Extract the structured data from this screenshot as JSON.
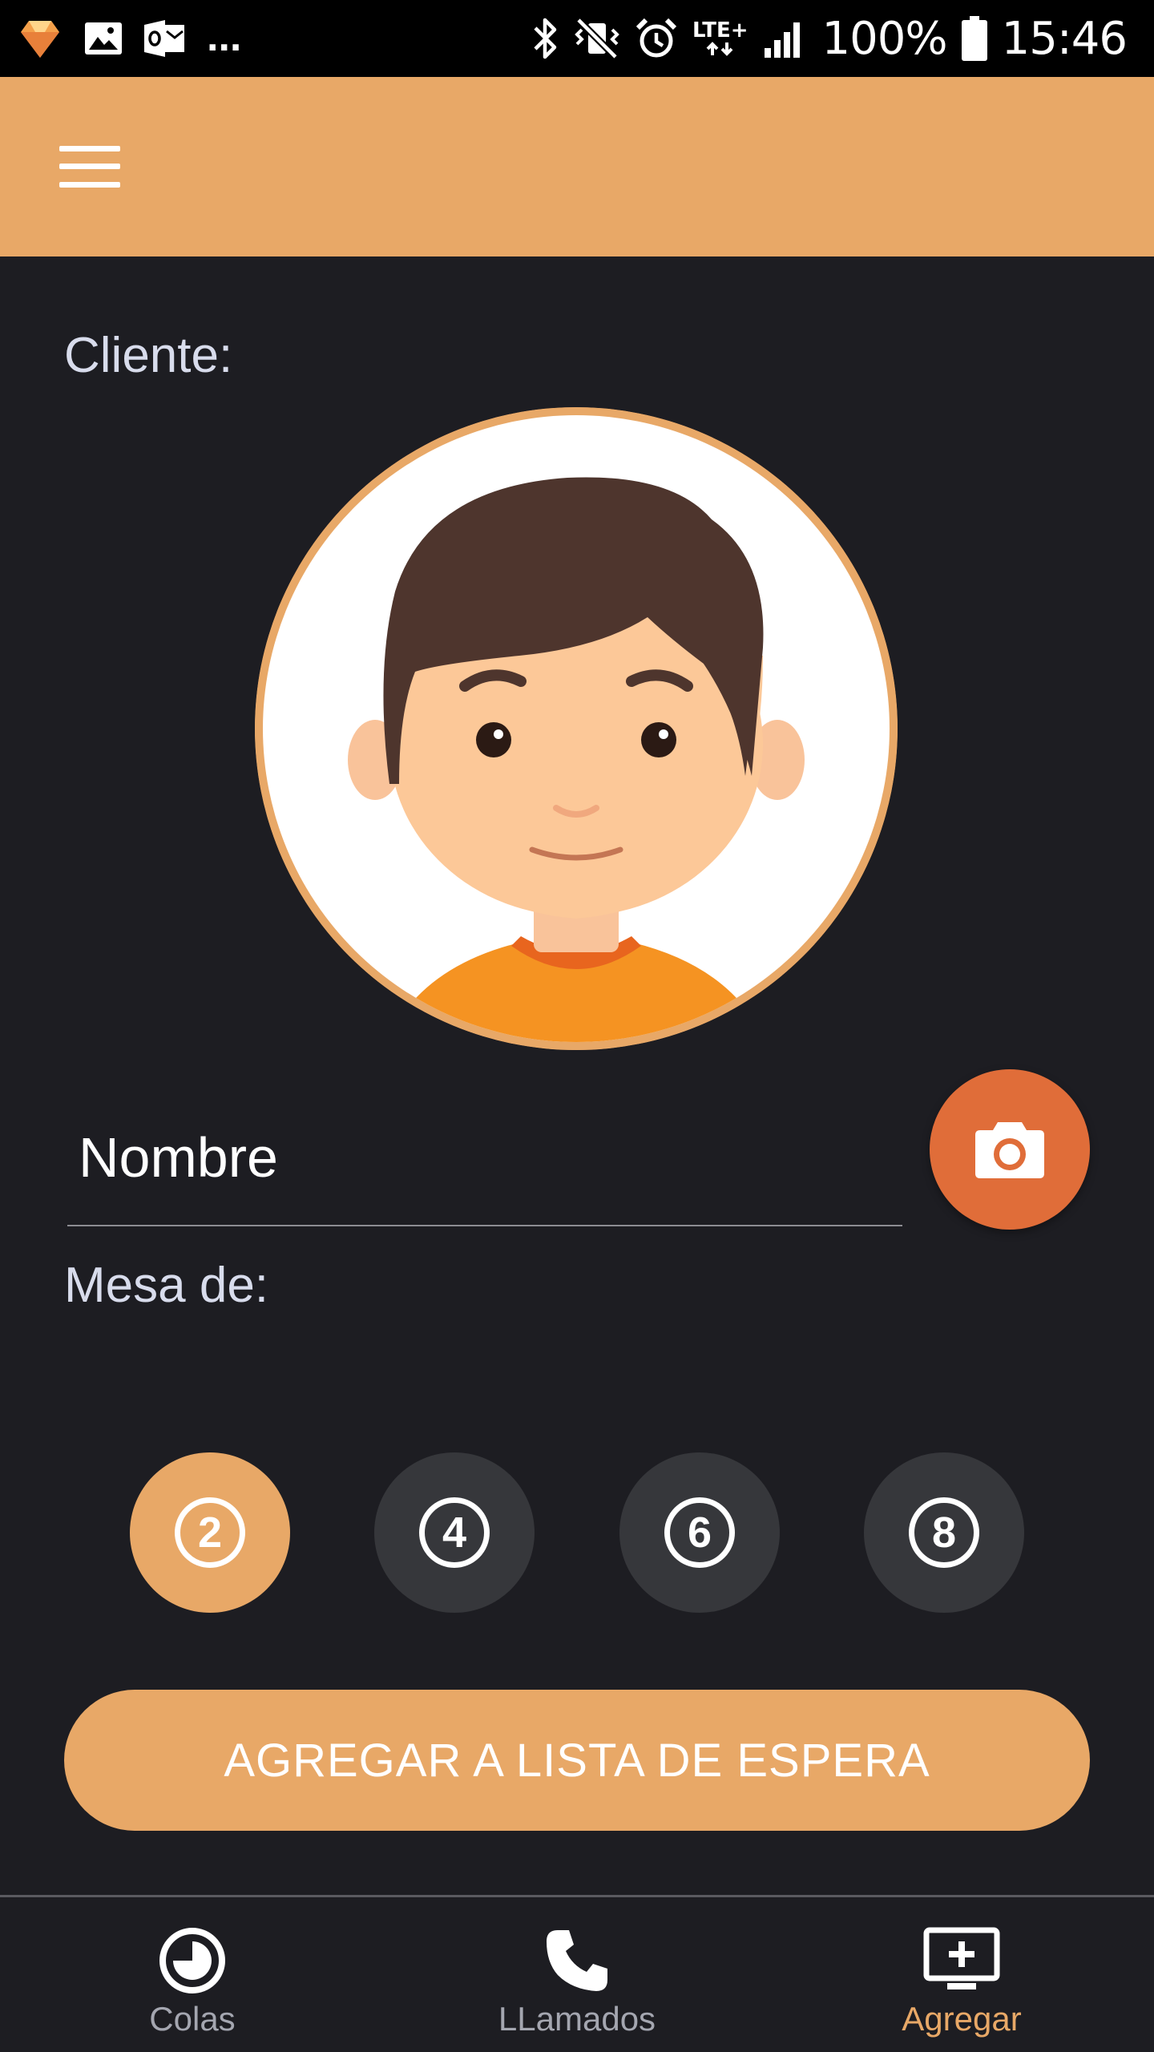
{
  "status_bar": {
    "overflow": "...",
    "network": "LTE+",
    "battery": "100%",
    "time": "15:46",
    "left_icons": [
      "diamond-app-icon",
      "image-icon",
      "outlook-icon"
    ],
    "right_icons": [
      "bluetooth-icon",
      "vibrate-mute-icon",
      "alarm-icon",
      "signal-icon",
      "battery-icon"
    ]
  },
  "app_bar": {
    "menu_icon": "hamburger-menu-icon",
    "color": "#e8a867"
  },
  "form": {
    "client_label": "Cliente:",
    "avatar_icon": "avatar-boy-icon",
    "name_placeholder": "Nombre",
    "name_value": "",
    "camera_icon": "camera-icon",
    "party_label": "Mesa de:",
    "party_sizes": [
      {
        "label": "2",
        "selected": true
      },
      {
        "label": "4",
        "selected": false
      },
      {
        "label": "6",
        "selected": false
      },
      {
        "label": "8",
        "selected": false
      }
    ],
    "submit_label": "AGREGAR A LISTA DE ESPERA"
  },
  "bottom_nav": {
    "items": [
      {
        "label": "Colas",
        "icon": "clock-pie-icon",
        "active": false
      },
      {
        "label": "LLamados",
        "icon": "phone-icon",
        "active": false
      },
      {
        "label": "Agregar",
        "icon": "add-to-screen-icon",
        "active": true
      }
    ]
  },
  "colors": {
    "accent": "#e8a867",
    "camera": "#e06d39",
    "background": "#1d1d22",
    "option_inactive": "#36373b",
    "label_text": "#d8dcec",
    "nav_inactive": "#a4a6b0"
  }
}
